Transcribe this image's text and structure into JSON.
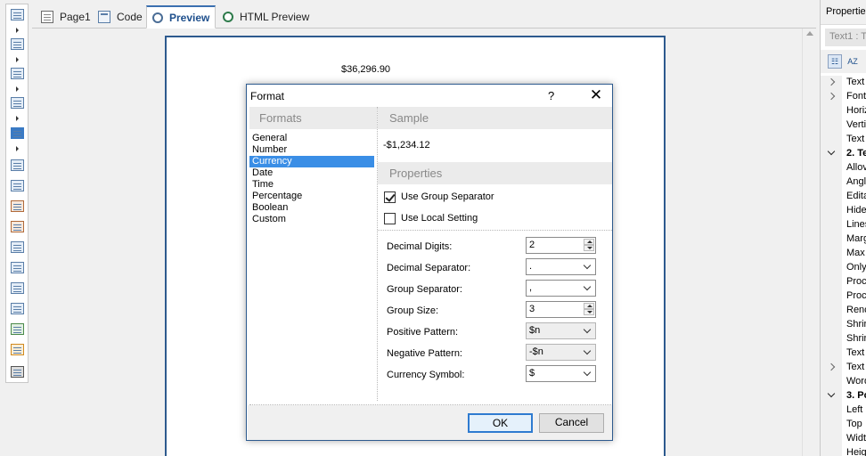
{
  "tabs": [
    {
      "label": "Page1",
      "icon": "page-icon"
    },
    {
      "label": "Code",
      "icon": "code-icon"
    },
    {
      "label": "Preview",
      "icon": "preview-icon",
      "active": true
    },
    {
      "label": "HTML Preview",
      "icon": "html-preview-icon"
    }
  ],
  "canvas": {
    "page_value": "$36,296.90"
  },
  "properties_panel": {
    "title": "Properties",
    "object_selector": "Text1 : T",
    "toolbar": {
      "categorized_label": "☷",
      "alphabetical_label": "AZ"
    },
    "rows": [
      {
        "label": "Text",
        "expandable": true
      },
      {
        "label": "Font",
        "expandable": true
      },
      {
        "label": "Horiz"
      },
      {
        "label": "Verti"
      },
      {
        "label": "Text"
      },
      {
        "label": "2. Te",
        "category": true
      },
      {
        "label": "Allov"
      },
      {
        "label": "Angl"
      },
      {
        "label": "Edita"
      },
      {
        "label": "Hide"
      },
      {
        "label": "Lines"
      },
      {
        "label": "Marg"
      },
      {
        "label": "Max"
      },
      {
        "label": "Only"
      },
      {
        "label": "Proc"
      },
      {
        "label": "Proc"
      },
      {
        "label": "Renc"
      },
      {
        "label": "Shrir"
      },
      {
        "label": "Shrir"
      },
      {
        "label": "Text"
      },
      {
        "label": "Text",
        "expandable": true
      },
      {
        "label": "Word"
      },
      {
        "label": "3. Po",
        "category": true
      },
      {
        "label": "Left"
      },
      {
        "label": "Top"
      },
      {
        "label": "Widt"
      },
      {
        "label": "Heig"
      }
    ]
  },
  "dialog": {
    "title": "Format",
    "help": "?",
    "close": "✕",
    "formats_header": "Formats",
    "formats": [
      "General",
      "Number",
      "Currency",
      "Date",
      "Time",
      "Percentage",
      "Boolean",
      "Custom"
    ],
    "selected_format": "Currency",
    "sample_header": "Sample",
    "sample": "-$1,234.12",
    "properties_header": "Properties",
    "use_group_separator": {
      "label": "Use Group Separator",
      "checked": true
    },
    "use_local_setting": {
      "label": "Use Local Setting",
      "checked": false
    },
    "fields": [
      {
        "label": "Decimal Digits:",
        "value": "2",
        "kind": "spin",
        "enabled": true
      },
      {
        "label": "Decimal Separator:",
        "value": ".",
        "kind": "select",
        "enabled": true
      },
      {
        "label": "Group Separator:",
        "value": ",",
        "kind": "select",
        "enabled": true
      },
      {
        "label": "Group Size:",
        "value": "3",
        "kind": "spin",
        "enabled": true
      },
      {
        "label": "Positive Pattern:",
        "value": "$n",
        "kind": "select",
        "enabled": false
      },
      {
        "label": "Negative Pattern:",
        "value": "-$n",
        "kind": "select",
        "enabled": false
      },
      {
        "label": "Currency Symbol:",
        "value": "$",
        "kind": "select",
        "enabled": true
      }
    ],
    "ok_label": "OK",
    "cancel_label": "Cancel"
  },
  "colors": {
    "accent": "#2d5a8e",
    "selection": "#3a8ee6",
    "header_bg": "#ebebeb"
  }
}
